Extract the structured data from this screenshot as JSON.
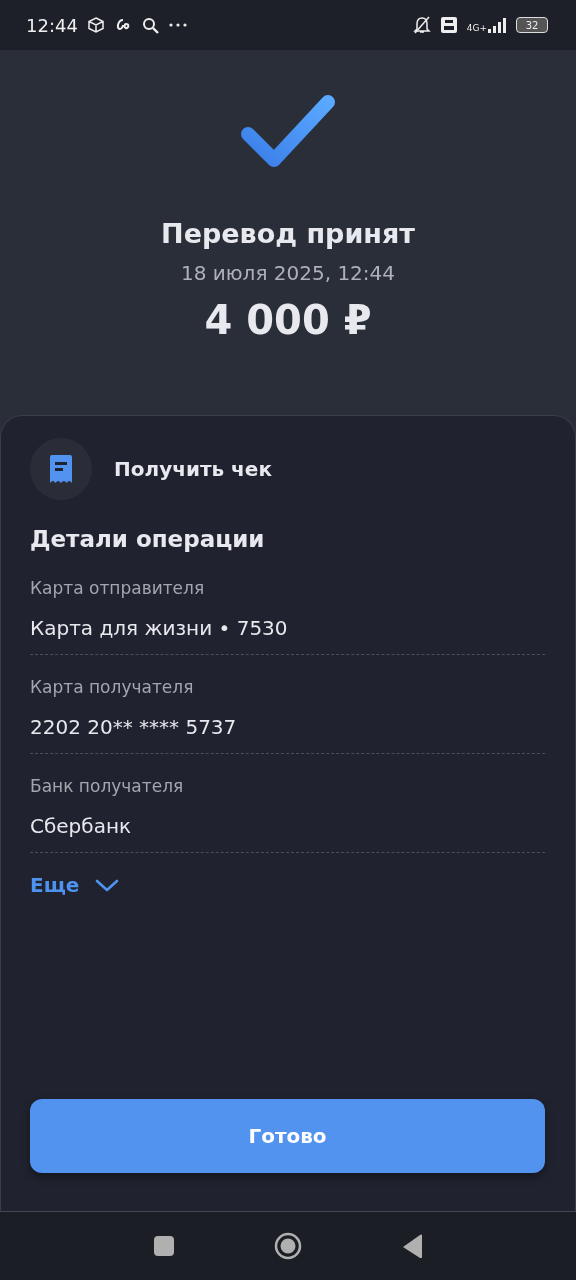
{
  "status_bar": {
    "time": "12:44",
    "network": "4G+",
    "battery": "32"
  },
  "result": {
    "title": "Перевод принят",
    "date": "18 июля 2025, 12:44",
    "amount": "4 000 ₽"
  },
  "receipt": {
    "label": "Получить чек"
  },
  "details": {
    "title": "Детали операции",
    "fields": [
      {
        "label": "Карта отправителя",
        "value": "Карта для жизни • 7530"
      },
      {
        "label": "Карта получателя",
        "value": "2202 20** **** 5737"
      },
      {
        "label": "Банк получателя",
        "value": "Сбербанк"
      }
    ],
    "more": {
      "label": "Еще",
      "expanded": false
    }
  },
  "done_button": {
    "label": "Готово"
  }
}
